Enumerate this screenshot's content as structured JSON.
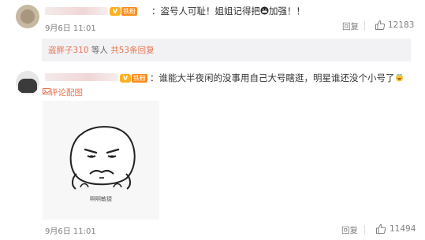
{
  "comments": [
    {
      "text": "：盗号人可耻！姐姐记得把",
      "text_end": "加强！！",
      "time": "9月6日 11:01",
      "reply_label": "回复",
      "likes": "12183",
      "vip_icon": "V",
      "fan_badge": "铁粉"
    },
    {
      "text": "：谁能大半夜闲的没事用自己大号瞎逛，明星谁还没个小号了",
      "image_link_label": "评论配图",
      "meme_caption": "啊啊敏捷",
      "time": "9月6日 11:01",
      "reply_label": "回复",
      "likes": "11494",
      "vip_icon": "V",
      "fan_badge": "铁粉"
    }
  ],
  "sub_replies": {
    "user": "盗胖子310",
    "middle": " 等人 ",
    "count_text": "共53条回复"
  },
  "colors": {
    "accent": "#eb7350",
    "muted": "#808080",
    "sub_bg": "#f2f2f5",
    "fan_badge": "#ff8c1a"
  }
}
